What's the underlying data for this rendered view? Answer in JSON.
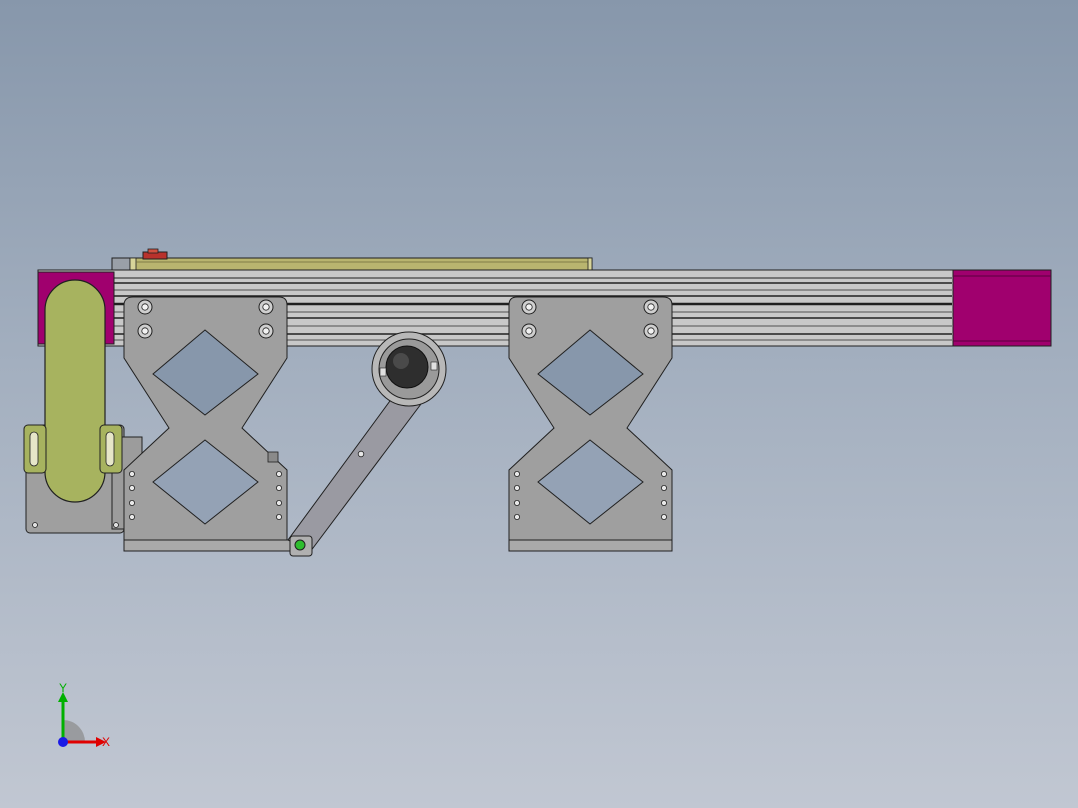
{
  "viewport": {
    "view_name": "Front",
    "background_colors": [
      "#8797ab",
      "#c1c7d2"
    ]
  },
  "model": {
    "colors": {
      "magenta_end_blocks": "#a0006e",
      "olive_parts": "#a7b35f",
      "olive_cover": "#b9b56f",
      "steel": "#9f9f9f",
      "steel_dark": "#5e5e5e",
      "outline": "#202020",
      "rail": "#c8c8c8",
      "highlight_green": "#2ebd2e",
      "red_knob": "#b8322c"
    }
  },
  "triad": {
    "x_label": "X",
    "y_label": "Y",
    "x_color": "#e00000",
    "y_color": "#00b000",
    "z_color": "#1a1ae6"
  }
}
